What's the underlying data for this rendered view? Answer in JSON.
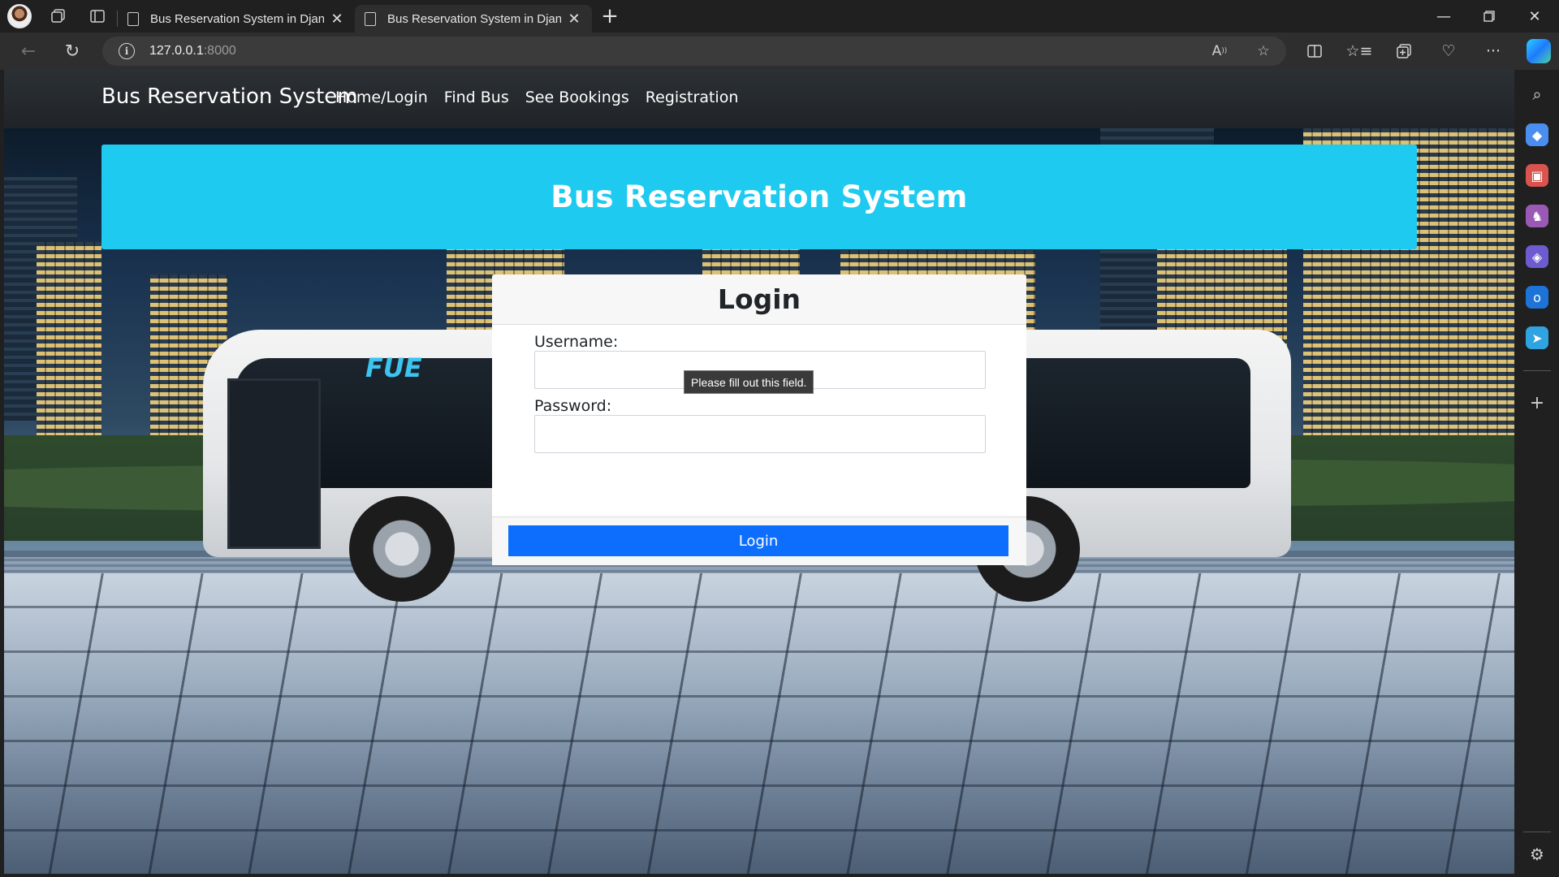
{
  "browser": {
    "tabs": [
      {
        "title": "Bus Reservation System in Djang",
        "active": false
      },
      {
        "title": "Bus Reservation System in Djang",
        "active": true
      }
    ],
    "url_host": "127.0.0.1",
    "url_port": ":8000",
    "accent": "#1fcaf0"
  },
  "site": {
    "brand": "Bus Reservation System",
    "nav": [
      "Home/Login",
      "Find Bus",
      "See Bookings",
      "Registration"
    ]
  },
  "hero": {
    "title": "Bus Reservation System"
  },
  "login": {
    "heading": "Login",
    "username_label": "Username:",
    "password_label": "Password:",
    "button": "Login",
    "validation_tooltip": "Please fill out this field."
  },
  "bus_logo_text": "FUE",
  "colors": {
    "button": "#0d6efd",
    "hero": "#1fcaf0",
    "navbar": "#212529"
  }
}
